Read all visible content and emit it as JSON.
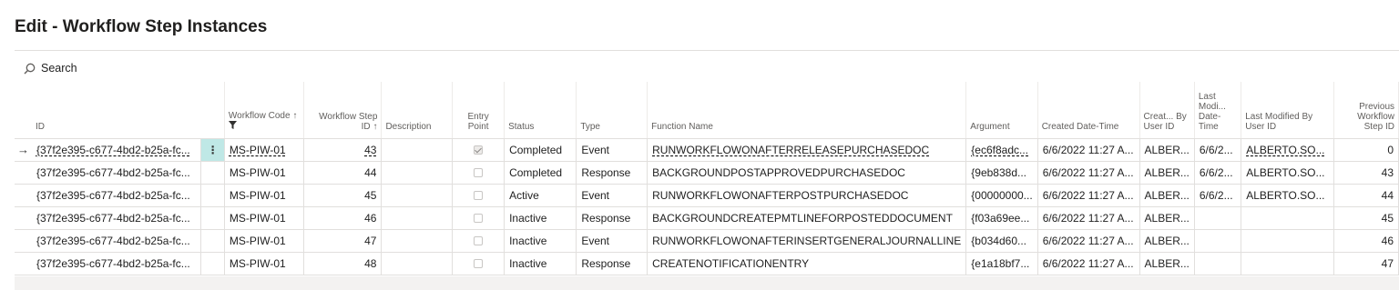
{
  "page": {
    "title": "Edit - Workflow Step Instances"
  },
  "search": {
    "label": "Search"
  },
  "columns": {
    "id": "ID",
    "workflow_code": "Workflow Code",
    "workflow_step_id": "Workflow Step ID",
    "description": "Description",
    "entry_point": "Entry Point",
    "status": "Status",
    "type": "Type",
    "function_name": "Function Name",
    "argument": "Argument",
    "created_datetime": "Created Date-Time",
    "created_by": "Creat... By User ID",
    "last_modified_datetime": "Last Modi... Date-Time",
    "last_modified_by": "Last Modified By User ID",
    "previous_step_id": "Previous Workflow Step ID"
  },
  "rows": [
    {
      "id": "{37f2e395-c677-4bd2-b25a-fc...",
      "workflow_code": "MS-PIW-01",
      "workflow_step_id": "43",
      "description": "",
      "entry_point": true,
      "status": "Completed",
      "type": "Event",
      "function_name": "RUNWORKFLOWONAFTERRELEASEPURCHASEDOC",
      "argument": "{ec6f8adc...",
      "created_datetime": "6/6/2022 11:27 A...",
      "created_by": "ALBER...",
      "last_modified_datetime": "6/6/2...",
      "last_modified_by": "ALBERTO.SO...",
      "previous_step_id": "0"
    },
    {
      "id": "{37f2e395-c677-4bd2-b25a-fc...",
      "workflow_code": "MS-PIW-01",
      "workflow_step_id": "44",
      "description": "",
      "entry_point": false,
      "status": "Completed",
      "type": "Response",
      "function_name": "BACKGROUNDPOSTAPPROVEDPURCHASEDOC",
      "argument": "{9eb838d...",
      "created_datetime": "6/6/2022 11:27 A...",
      "created_by": "ALBER...",
      "last_modified_datetime": "6/6/2...",
      "last_modified_by": "ALBERTO.SO...",
      "previous_step_id": "43"
    },
    {
      "id": "{37f2e395-c677-4bd2-b25a-fc...",
      "workflow_code": "MS-PIW-01",
      "workflow_step_id": "45",
      "description": "",
      "entry_point": false,
      "status": "Active",
      "type": "Event",
      "function_name": "RUNWORKFLOWONAFTERPOSTPURCHASEDOC",
      "argument": "{00000000...",
      "created_datetime": "6/6/2022 11:27 A...",
      "created_by": "ALBER...",
      "last_modified_datetime": "6/6/2...",
      "last_modified_by": "ALBERTO.SO...",
      "previous_step_id": "44"
    },
    {
      "id": "{37f2e395-c677-4bd2-b25a-fc...",
      "workflow_code": "MS-PIW-01",
      "workflow_step_id": "46",
      "description": "",
      "entry_point": false,
      "status": "Inactive",
      "type": "Response",
      "function_name": "BACKGROUNDCREATEPMTLINEFORPOSTEDDOCUMENT",
      "argument": "{f03a69ee...",
      "created_datetime": "6/6/2022 11:27 A...",
      "created_by": "ALBER...",
      "last_modified_datetime": "",
      "last_modified_by": "",
      "previous_step_id": "45"
    },
    {
      "id": "{37f2e395-c677-4bd2-b25a-fc...",
      "workflow_code": "MS-PIW-01",
      "workflow_step_id": "47",
      "description": "",
      "entry_point": false,
      "status": "Inactive",
      "type": "Event",
      "function_name": "RUNWORKFLOWONAFTERINSERTGENERALJOURNALLINE",
      "argument": "{b034d60...",
      "created_datetime": "6/6/2022 11:27 A...",
      "created_by": "ALBER...",
      "last_modified_datetime": "",
      "last_modified_by": "",
      "previous_step_id": "46"
    },
    {
      "id": "{37f2e395-c677-4bd2-b25a-fc...",
      "workflow_code": "MS-PIW-01",
      "workflow_step_id": "48",
      "description": "",
      "entry_point": false,
      "status": "Inactive",
      "type": "Response",
      "function_name": "CREATENOTIFICATIONENTRY",
      "argument": "{e1a18bf7...",
      "created_datetime": "6/6/2022 11:27 A...",
      "created_by": "ALBER...",
      "last_modified_datetime": "",
      "last_modified_by": "",
      "previous_step_id": "47"
    }
  ],
  "current_row": 0,
  "icons": {
    "search": "search-icon",
    "filter": "filter-icon",
    "sort": "sort-ascending-icon",
    "row_indicator": "arrow-right-icon",
    "row_actions": "more-vertical-icon"
  },
  "colors": {
    "row_actions_bg": "#bfe8e6",
    "border": "#e1dfdd",
    "header_text": "#605e5c"
  }
}
